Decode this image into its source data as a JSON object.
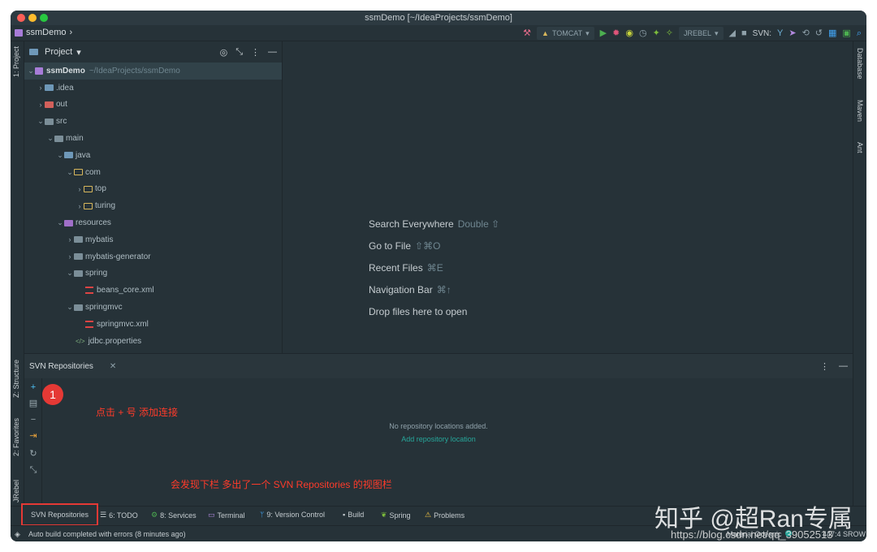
{
  "window": {
    "title": "ssmDemo [~/IdeaProjects/ssmDemo]"
  },
  "navbar": {
    "project": "ssmDemo",
    "run_config": "TOMCAT",
    "jrebel_config": "JREBEL",
    "svn_label": "SVN:"
  },
  "left_tabs": {
    "project": "1: Project",
    "structure": "Z: Structure",
    "favorites": "2: Favorites",
    "jrebel": "JRebel"
  },
  "right_tabs": {
    "database": "Database",
    "maven": "Maven",
    "ant": "Ant"
  },
  "project_panel": {
    "title": "Project",
    "tree": [
      {
        "label": "ssmDemo",
        "path": "~/IdeaProjects/ssmDemo"
      },
      {
        "label": ".idea"
      },
      {
        "label": "out"
      },
      {
        "label": "src"
      },
      {
        "label": "main"
      },
      {
        "label": "java"
      },
      {
        "label": "com"
      },
      {
        "label": "top"
      },
      {
        "label": "turing"
      },
      {
        "label": "resources"
      },
      {
        "label": "mybatis"
      },
      {
        "label": "mybatis-generator"
      },
      {
        "label": "spring"
      },
      {
        "label": "beans_core.xml"
      },
      {
        "label": "springmvc"
      },
      {
        "label": "springmvc.xml"
      },
      {
        "label": "jdbc.properties"
      }
    ]
  },
  "editor_hints": [
    {
      "label": "Search Everywhere",
      "shortcut": "Double ⇧"
    },
    {
      "label": "Go to File",
      "shortcut": "⇧⌘O"
    },
    {
      "label": "Recent Files",
      "shortcut": "⌘E"
    },
    {
      "label": "Navigation Bar",
      "shortcut": "⌘↑"
    },
    {
      "label": "Drop files here to open",
      "shortcut": ""
    }
  ],
  "svn_panel": {
    "title": "SVN Repositories",
    "empty_message": "No repository locations added.",
    "add_link": "Add repository location",
    "callout_number": "1"
  },
  "annotations": {
    "plus_hint": "点击 + 号 添加连接",
    "bottom_hint": "会发现下栏 多出了一个 SVN  Repositories 的视图栏"
  },
  "bottom_tabs": [
    {
      "label": "SVN Repositories"
    },
    {
      "label": "6: TODO"
    },
    {
      "label": "8: Services"
    },
    {
      "label": "Terminal"
    },
    {
      "label": "9: Version Control"
    },
    {
      "label": "Build"
    },
    {
      "label": "Spring"
    },
    {
      "label": "Problems"
    }
  ],
  "status": {
    "message": "Auto build completed with errors (8 minutes ago)",
    "theme": "Material Oceanic",
    "position": "447:4 SROW"
  },
  "watermark": {
    "main": "知乎 @超Ran专属",
    "url": "https://blog.csdn.net/qq_39052513"
  },
  "colors": {
    "accent_red": "#e53935",
    "link_teal": "#26a69a",
    "background": "#263238"
  }
}
